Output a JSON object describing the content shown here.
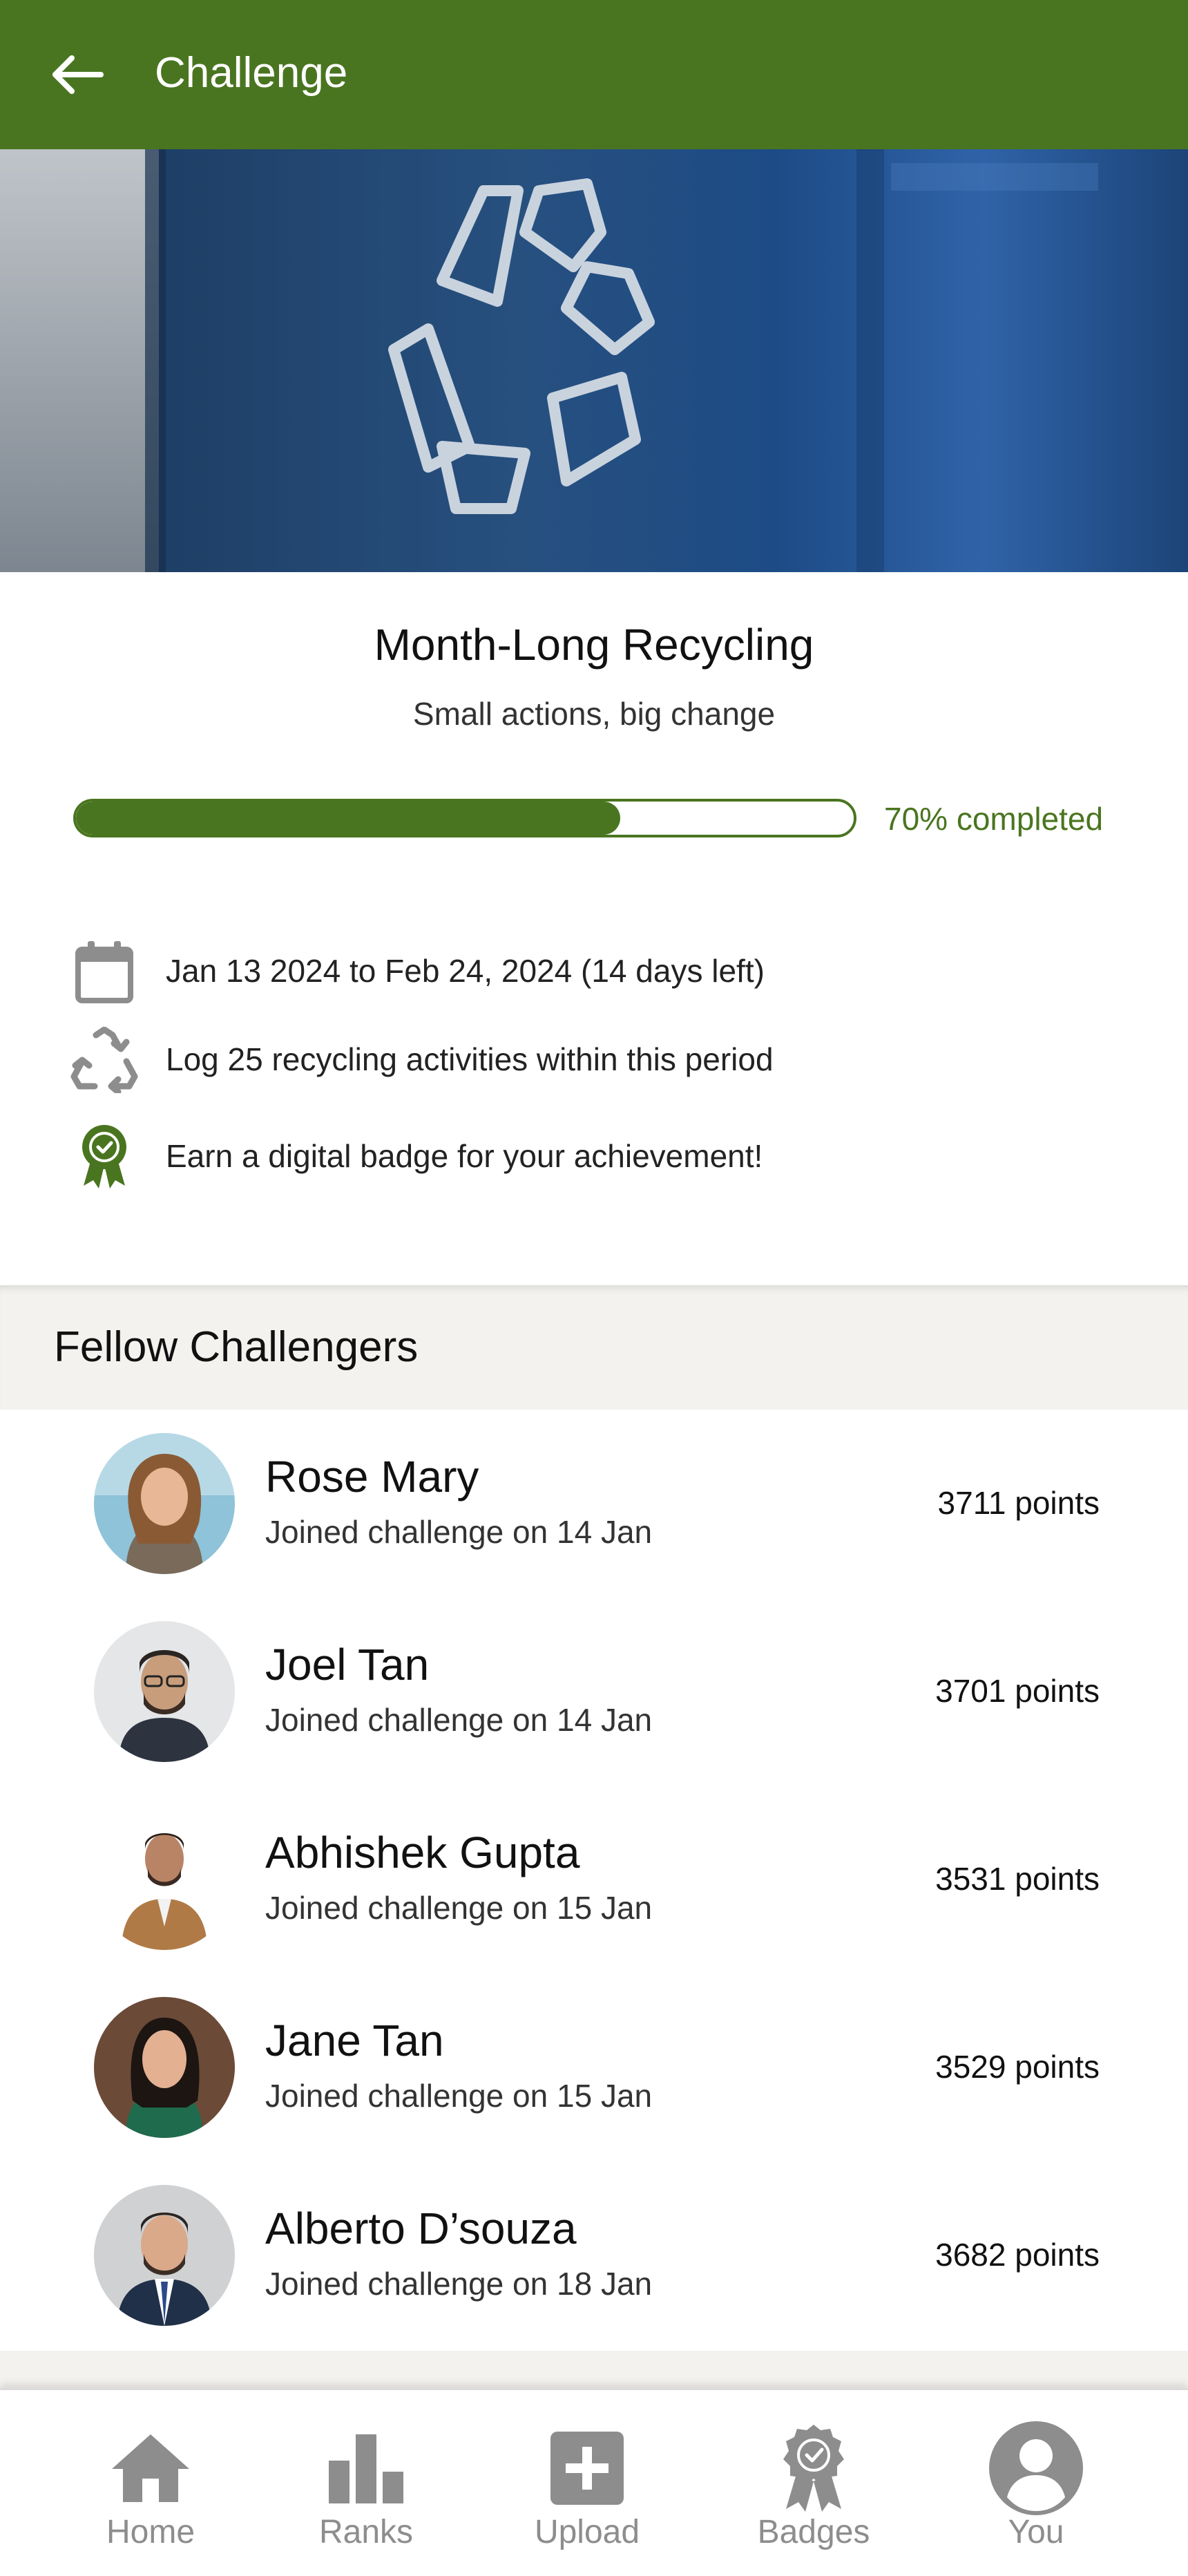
{
  "header": {
    "title": "Challenge",
    "back_icon": "arrow-left-icon"
  },
  "hero": {
    "image": "recycling-bin-photo"
  },
  "challenge": {
    "title": "Month-Long Recycling",
    "subtitle": "Small actions, big change",
    "progress": 0.7,
    "progress_label": "70% completed",
    "details": [
      {
        "icon": "calendar-icon",
        "text": "Jan 13 2024 to Feb 24, 2024 (14 days left)"
      },
      {
        "icon": "recycle-icon",
        "text": "Log 25 recycling activities within this period"
      },
      {
        "icon": "badge-icon",
        "text": "Earn a digital badge for your achievement!"
      }
    ]
  },
  "fellow": {
    "title": "Fellow Challengers",
    "people": [
      {
        "name": "Rose Mary",
        "joined": "Joined challenge on 14 Jan",
        "points": "3711 points"
      },
      {
        "name": "Joel Tan",
        "joined": "Joined challenge on 14 Jan",
        "points": "3701 points"
      },
      {
        "name": "Abhishek Gupta",
        "joined": "Joined challenge on 15 Jan",
        "points": "3531 points"
      },
      {
        "name": "Jane Tan",
        "joined": "Joined challenge on 15 Jan",
        "points": "3529 points"
      },
      {
        "name": "Alberto D’souza",
        "joined": "Joined challenge on 18 Jan",
        "points": "3682 points"
      }
    ]
  },
  "nav": {
    "items": [
      {
        "label": "Home",
        "icon": "home-icon"
      },
      {
        "label": "Ranks",
        "icon": "bar-chart-icon"
      },
      {
        "label": "Upload",
        "icon": "plus-box-icon"
      },
      {
        "label": "Badges",
        "icon": "badge-icon"
      },
      {
        "label": "You",
        "icon": "user-icon"
      }
    ]
  },
  "colors": {
    "primary": "#4a7520",
    "nav_grey": "#8d8d8d",
    "section_bg": "#f3f2ee"
  }
}
